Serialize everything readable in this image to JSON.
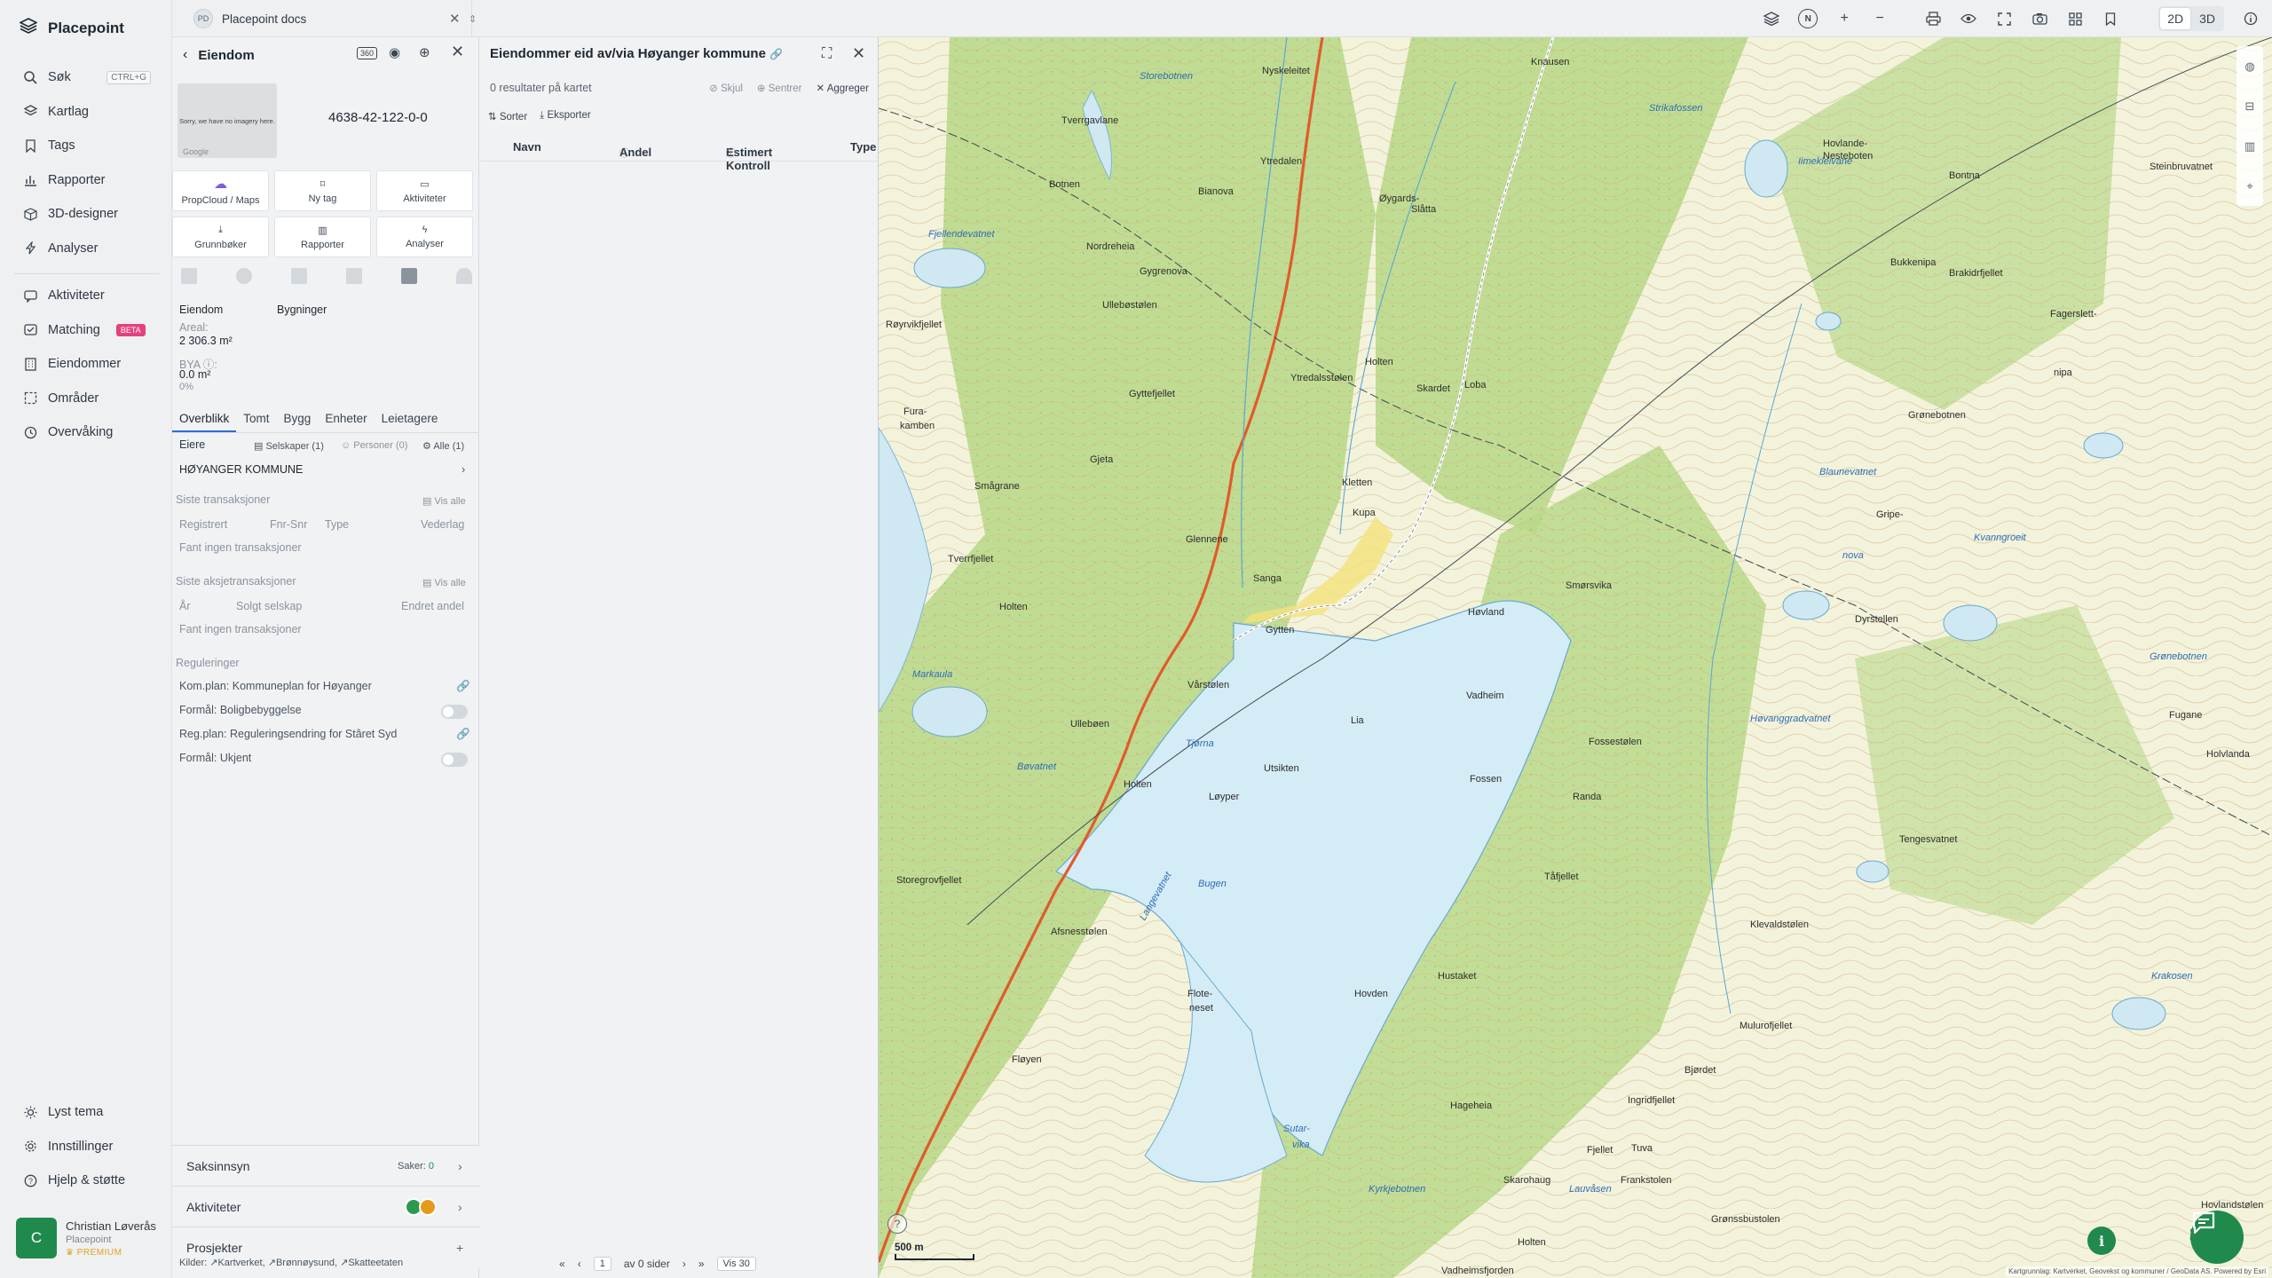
{
  "app": {
    "name": "Placepoint"
  },
  "nav": {
    "items": [
      {
        "label": "Søk",
        "shortcut": "CTRL+G"
      },
      {
        "label": "Kartlag"
      },
      {
        "label": "Tags"
      },
      {
        "label": "Rapporter"
      },
      {
        "label": "3D-designer"
      },
      {
        "label": "Analyser"
      }
    ],
    "items2": [
      {
        "label": "Aktiviteter"
      },
      {
        "label": "Matching",
        "badge": "BETA"
      },
      {
        "label": "Eiendommer"
      },
      {
        "label": "Områder"
      },
      {
        "label": "Overvåking"
      }
    ],
    "bottom": [
      {
        "label": "Lyst tema"
      },
      {
        "label": "Innstillinger"
      },
      {
        "label": "Hjelp & støtte"
      }
    ]
  },
  "user": {
    "initial": "C",
    "name": "Christian Løverås",
    "org": "Placepoint",
    "plan": "PREMIUM"
  },
  "tab": {
    "logo": "PD",
    "title": "Placepoint docs",
    "close": "✕"
  },
  "toolbar": {
    "compass": "N",
    "zoom_in": "+",
    "zoom_out": "−",
    "mode_2d": "2D",
    "mode_3d": "3D"
  },
  "property": {
    "title": "Eiendom",
    "badge": "360",
    "image_placeholder": "Sorry, we have no imagery here.",
    "image_credit": "Google",
    "id": "4638-42-122-0-0",
    "actions": [
      "PropCloud / Maps",
      "Ny tag",
      "Aktiviteter",
      "Grunnbøker",
      "Rapporter",
      "Analyser"
    ],
    "subheads": [
      "Eiendom",
      "Bygninger"
    ],
    "area_label": "Areal:",
    "area_value": "2 306.3",
    "area_unit": "m²",
    "bya_label": "BYA ⓘ:",
    "bya_value": "0.0 m²",
    "bya_pct": "0%",
    "tabs": [
      "Overblikk",
      "Tomt",
      "Bygg",
      "Enheter",
      "Leietagere"
    ],
    "owners_label": "Eiere",
    "owners_filters": [
      "Selskaper (1)",
      "Personer (0)",
      "Alle (1)"
    ],
    "owner": "HØYANGER KOMMUNE",
    "tx_title": "Siste transaksjoner",
    "show_all": "Vis alle",
    "tx_cols": [
      "Registrert",
      "Fnr-Snr",
      "Type",
      "Vederlag"
    ],
    "tx_empty": "Fant ingen transaksjoner",
    "stx_title": "Siste aksjetransaksjoner",
    "stx_cols": [
      "År",
      "Solgt selskap",
      "Endret andel"
    ],
    "stx_empty": "Fant ingen transaksjoner",
    "reg_title": "Reguleringer",
    "regs": [
      "Kom.plan: Kommuneplan for Høyanger",
      "Formål: Boligbebyggelse",
      "Reg.plan: Reguleringsendring for Stâret Syd",
      "Formål: Ukjent"
    ],
    "accordions": [
      {
        "label": "Saksinnsyn",
        "meta": "Saker:",
        "count": "0"
      },
      {
        "label": "Aktiviteter"
      },
      {
        "label": "Prosjekter"
      }
    ],
    "clients_label": "Kilder:",
    "clients": [
      "Kartverket,",
      "Brønnøysund,",
      "Skatteetaten"
    ]
  },
  "list": {
    "title": "Eiendommer eid av/via Høyanger kommune",
    "summary": "0 resultater på kartet",
    "actions": [
      "Skjul",
      "Sentrer",
      "Aggreger"
    ],
    "buttons": [
      "Sorter",
      "Eksporter"
    ],
    "columns": [
      "Navn",
      "Andel",
      "Estimert Kontroll",
      "Type"
    ],
    "pager": {
      "page": "1",
      "of_pages": "av 0 sider",
      "per_page": "Vis 30"
    }
  },
  "map": {
    "scale": "500 m",
    "attribution": "Kartgrunnlag: Kartverket, Geovekst og kommuner / GeoData AS. Powered by Esri",
    "places": [
      "Knausen",
      "Nyskeleitet",
      "Tverrgavlane",
      "Botnen",
      "Bianova",
      "Ytredalen",
      "Øygards-",
      "Slåtta",
      "Strikafossen",
      "Nordreheia",
      "Gygrenova",
      "Fjellendevatnet",
      "Ullebøstølen",
      "Røyrvikfjellet",
      "Gyttefjellet",
      "Holten",
      "Ytredalsstølen",
      "Skardet",
      "Loba",
      "Kletten",
      "Fura-",
      "kamben",
      "Gjeta",
      "Kupa",
      "Smågrane",
      "Glennene",
      "Sanga",
      "Gytten",
      "Høvland",
      "Vadheim",
      "Tverrfjellet",
      "Holten",
      "Markaula",
      "Vårstølen",
      "Lia",
      "Ullebøen",
      "Tjørna",
      "Utsikten",
      "Bøvatnet",
      "Holten",
      "Løyper",
      "Storegrovfjellet",
      "Bugen",
      "Afsnesstølen",
      "Flote-",
      "neset",
      "Fløyen",
      "Hovden",
      "Hustaket",
      "Sutar-",
      "vika",
      "Hageheia",
      "Fagerslett-",
      "nipa",
      "Bukkenipa",
      "Fossestølen",
      "Fossen",
      "Randa",
      "Tåfjellet",
      "Klevaldstølen",
      "Krakosen",
      "Mulurofjellet",
      "Bjørdet",
      "Ingridfjellet",
      "Tuva",
      "Fjellet",
      "Frankstolen",
      "Skarohaug",
      "Holten",
      "Grønssbustolen",
      "Vadheimsfjorden",
      "Langevatnet",
      "Grønebotnen",
      "Fugane",
      "Holvlanda",
      "Smørsvika",
      "Lauvåsen",
      "Kyrkjebotnen",
      "Hovlandstølen",
      "Hovlande-",
      "Nesteboten",
      "Steinbruvatnet",
      "Storebotnen",
      "Høvanggradvatnet",
      "Blaunevatnet",
      "Kvanngroeit",
      "Gripe-",
      "nova",
      "Dyrstellen",
      "Tengesvatnet",
      "Iimekleivane",
      "Bontna",
      "Brakidrfjellet",
      "Grønebotnen"
    ]
  }
}
